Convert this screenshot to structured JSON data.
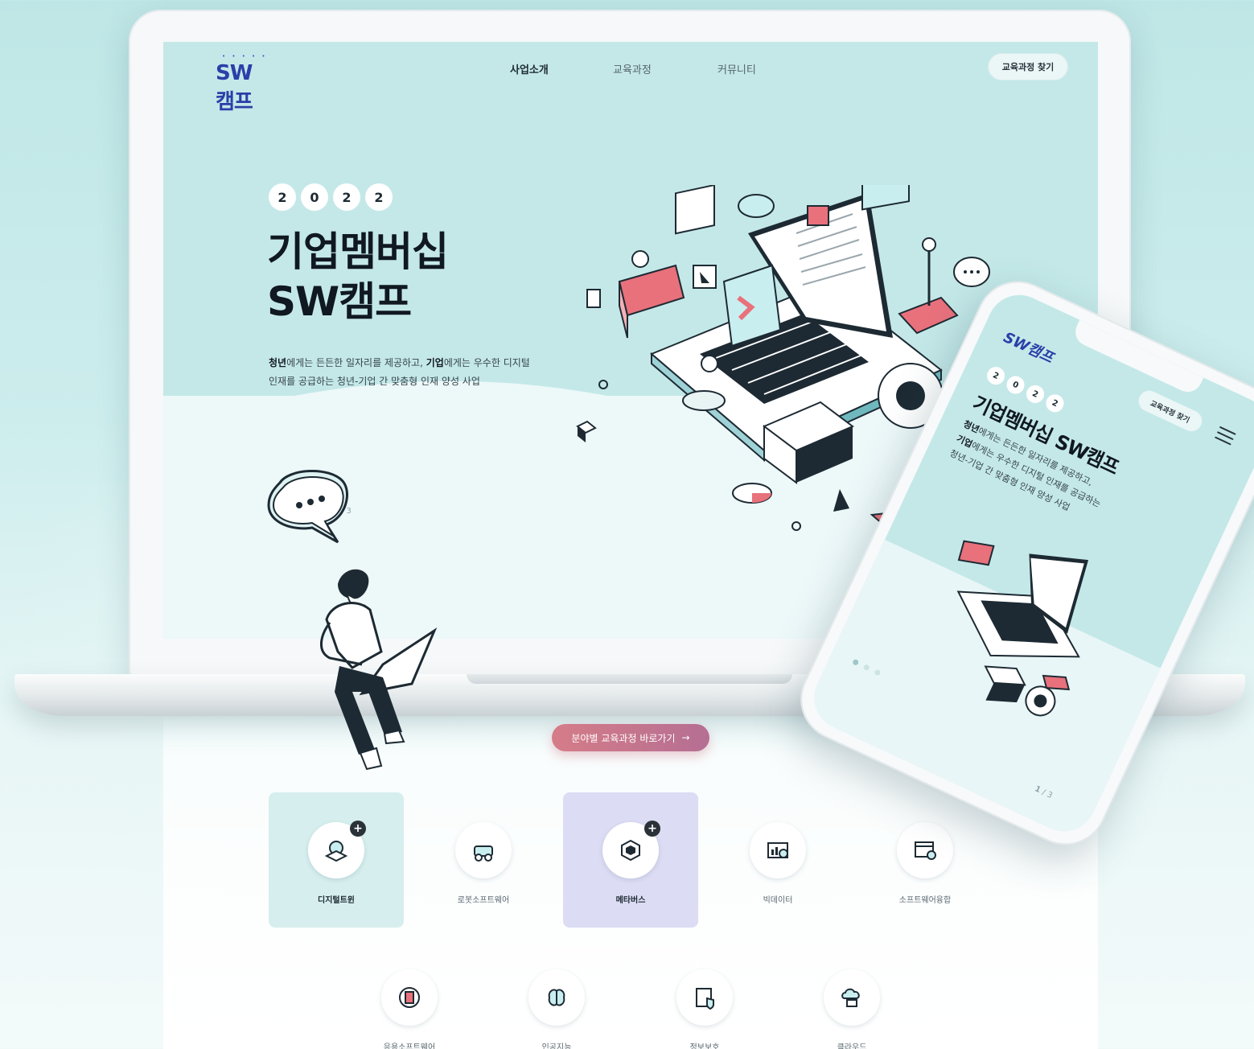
{
  "header": {
    "logo_text": "SW캠프",
    "nav": [
      {
        "label": "사업소개",
        "active": true
      },
      {
        "label": "교육과정",
        "active": false
      },
      {
        "label": "커뮤니티",
        "active": false
      }
    ],
    "find_course_button": "교육과정 찾기"
  },
  "hero": {
    "year_digits": [
      "2",
      "0",
      "2",
      "2"
    ],
    "title_line1": "기업멤버십",
    "title_line2": "SW캠프",
    "desc_line1_bold1": "청년",
    "desc_line1_part1": "에게는 든든한 일자리를 제공하고, ",
    "desc_line1_bold2": "기업",
    "desc_line1_part2": "에게는 우수한 디지털",
    "desc_line2": "인재를 공급하는 청년-기업 간 맞춤형 인재 양성 사업",
    "pager": "/ 3"
  },
  "cta": {
    "label": "분야별 교육과정 바로가기",
    "arrow": "→"
  },
  "categories_row1": [
    {
      "label": "디지털트윈",
      "icon": "digital-twin-icon",
      "highlight": "teal",
      "plus": true
    },
    {
      "label": "로봇소프트웨어",
      "icon": "robot-icon",
      "highlight": "",
      "plus": false
    },
    {
      "label": "메타버스",
      "icon": "metaverse-icon",
      "highlight": "lavender",
      "plus": true
    },
    {
      "label": "빅데이터",
      "icon": "bigdata-icon",
      "highlight": "",
      "plus": false
    },
    {
      "label": "소프트웨어융합",
      "icon": "software-convergence-icon",
      "highlight": "",
      "plus": false
    }
  ],
  "categories_row2": [
    {
      "label": "응용소프트웨어",
      "icon": "application-icon"
    },
    {
      "label": "인공지능",
      "icon": "ai-brain-icon"
    },
    {
      "label": "정보보호",
      "icon": "security-icon"
    },
    {
      "label": "클라우드",
      "icon": "cloud-icon"
    }
  ],
  "phone": {
    "logo_text": "SW캠프",
    "find_course_button": "교육과정 찾기",
    "year_digits": [
      "2",
      "0",
      "2",
      "2"
    ],
    "title": "기업멤버십 SW캠프",
    "desc_line1_bold": "청년",
    "desc_line1_rest": "에게는 든든한 일자리를 제공하고,",
    "desc_line2_bold": "기업",
    "desc_line2_rest": "에게는 우수한 디지털 인재를 공급하는",
    "desc_line3": "청년-기업 간 맞춤형 인재 양성 사업",
    "pager_current": "1",
    "pager_total": "/ 3"
  },
  "colors": {
    "background": "#c4e8e8",
    "brand_blue": "#2a3fa8",
    "cta_pink": "#d57c88",
    "highlight_teal": "#d6eeee",
    "highlight_lavender": "#dcdcf4",
    "accent_red": "#e8717c"
  }
}
